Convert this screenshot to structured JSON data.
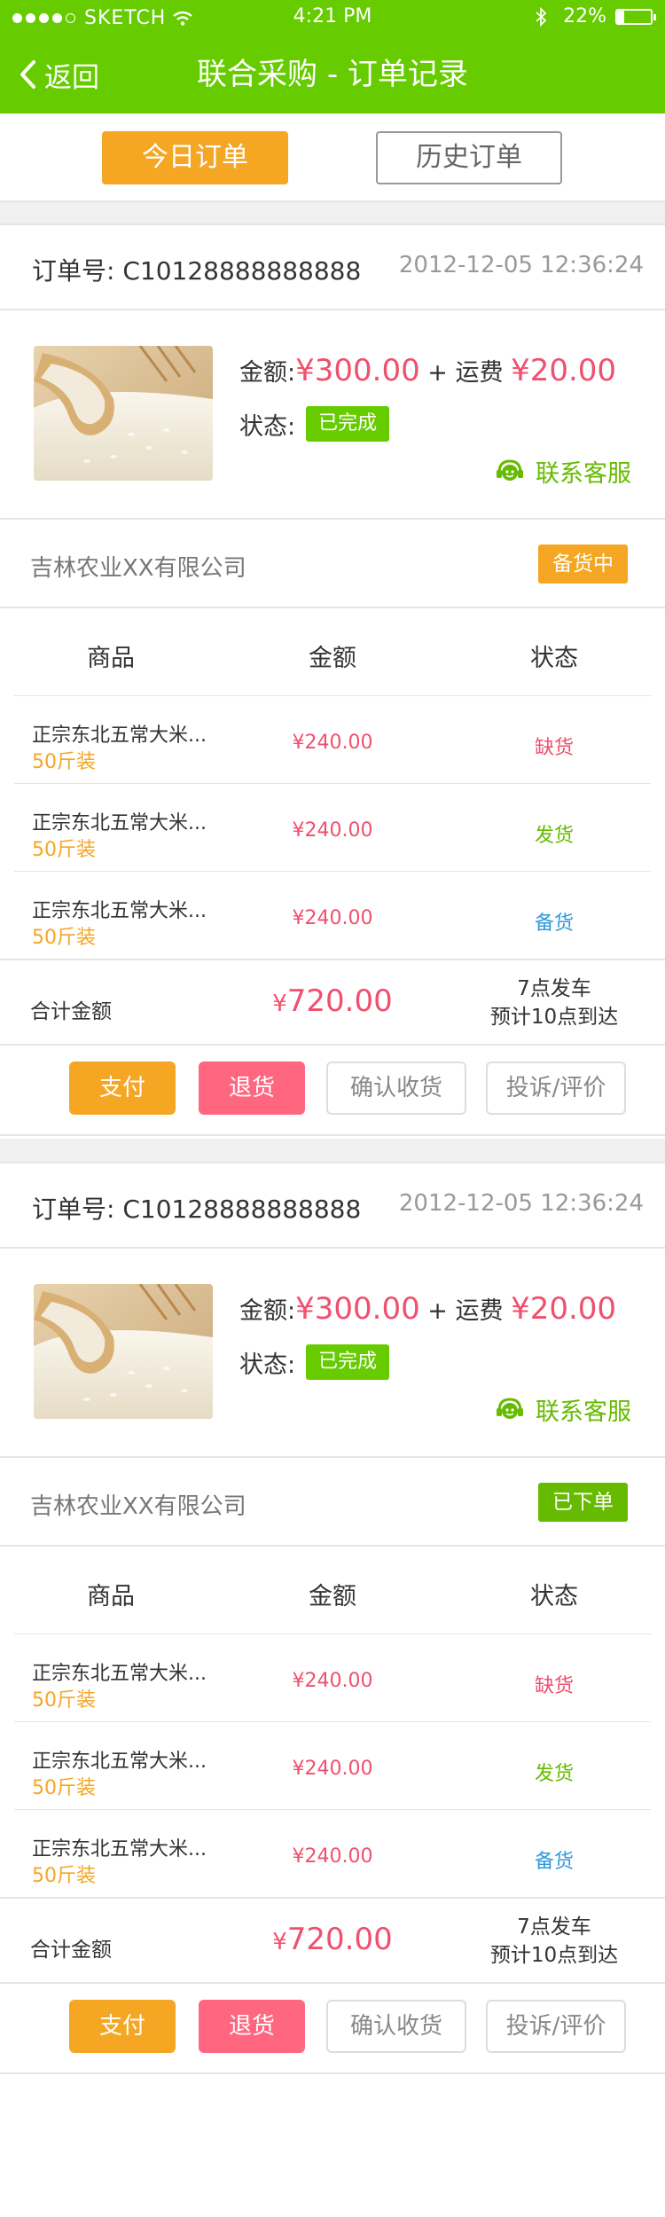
{
  "status_bar": {
    "carrier": "SKETCH",
    "time": "4:21 PM",
    "battery": "22%",
    "battery_level": 0.22
  },
  "nav": {
    "back_label": "返回",
    "title": "联合采购 - 订单记录"
  },
  "tabs": [
    {
      "label": "今日订单",
      "active": true
    },
    {
      "label": "历史订单",
      "active": false
    }
  ],
  "table_headers": {
    "product": "商品",
    "amount": "金额",
    "status": "状态"
  },
  "labels": {
    "amount": "金额:",
    "plus_shipping": " + 运费 ",
    "status": "状态:",
    "contact": "联系客服",
    "total": "合计金额"
  },
  "orders": [
    {
      "order_no": "订单号: C10128888888888",
      "time": "2012-12-05 12:36:24",
      "amount": "¥300.00",
      "shipping": "¥20.00",
      "status": "已完成",
      "company": "吉林农业XX有限公司",
      "company_status": "备货中",
      "company_status_color": "#f5a623",
      "items": [
        {
          "name": "正宗东北五常大米...",
          "spec": "50斤装",
          "price": "¥240.00",
          "status": "缺货",
          "status_color": "#f0506e"
        },
        {
          "name": "正宗东北五常大米...",
          "spec": "50斤装",
          "price": "¥240.00",
          "status": "发货",
          "status_color": "#66bb00"
        },
        {
          "name": "正宗东北五常大米...",
          "spec": "50斤装",
          "price": "¥240.00",
          "status": "备货",
          "status_color": "#3399dd"
        }
      ],
      "total_symbol": "¥",
      "total": "720.00",
      "delivery_line1": "7点发车",
      "delivery_line2": "预计10点到达",
      "actions": {
        "pay": "支付",
        "return": "退货",
        "confirm": "确认收货",
        "complain": "投诉/评价"
      }
    },
    {
      "order_no": "订单号: C10128888888888",
      "time": "2012-12-05 12:36:24",
      "amount": "¥300.00",
      "shipping": "¥20.00",
      "status": "已完成",
      "company": "吉林农业XX有限公司",
      "company_status": "已下单",
      "company_status_color": "#66bb00",
      "items": [
        {
          "name": "正宗东北五常大米...",
          "spec": "50斤装",
          "price": "¥240.00",
          "status": "缺货",
          "status_color": "#f0506e"
        },
        {
          "name": "正宗东北五常大米...",
          "spec": "50斤装",
          "price": "¥240.00",
          "status": "发货",
          "status_color": "#66bb00"
        },
        {
          "name": "正宗东北五常大米...",
          "spec": "50斤装",
          "price": "¥240.00",
          "status": "备货",
          "status_color": "#3399dd"
        }
      ],
      "total_symbol": "¥",
      "total": "720.00",
      "delivery_line1": "7点发车",
      "delivery_line2": "预计10点到达",
      "actions": {
        "pay": "支付",
        "return": "退货",
        "confirm": "确认收货",
        "complain": "投诉/评价"
      }
    }
  ],
  "colors": {
    "brand_green": "#66cc00",
    "accent_orange": "#f5a623",
    "price_red": "#f0506e",
    "return_pink": "#ff6680"
  },
  "icons": {
    "back": "chevron-left-icon",
    "wifi": "wifi-icon",
    "bluetooth": "bluetooth-icon",
    "battery": "battery-icon",
    "contact": "customer-service-icon",
    "product": "rice-product-image"
  }
}
